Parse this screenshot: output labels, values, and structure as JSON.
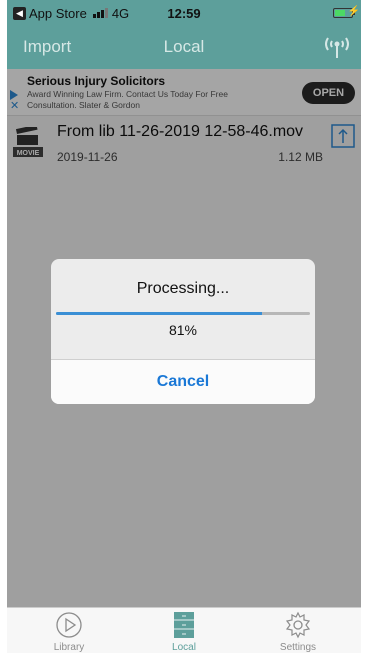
{
  "status_bar": {
    "back_app": "App Store",
    "carrier": "4G",
    "time": "12:59"
  },
  "nav": {
    "import_label": "Import",
    "title": "Local",
    "wifi_icon": "wifi-broadcast-icon"
  },
  "ad": {
    "title": "Serious Injury Solicitors",
    "body": "Award Winning Law Firm. Contact Us Today For Free Consultation. Slater & Gordon",
    "open_label": "OPEN",
    "icons": [
      "ad-play-icon",
      "ad-close-icon"
    ]
  },
  "files": [
    {
      "name": "From lib 11-26-2019 12-58-46.mov",
      "date": "2019-11-26",
      "size": "1.12 MB",
      "thumb_label": "MOVIE",
      "icon": "movie-clapper-icon",
      "action_icon": "upload-icon"
    }
  ],
  "dialog": {
    "title": "Processing...",
    "progress_text": "81%",
    "progress_fraction": 0.81,
    "cancel_label": "Cancel"
  },
  "tabbar": {
    "items": [
      {
        "label": "Library",
        "icon": "play-circle-icon",
        "active": false
      },
      {
        "label": "Local",
        "icon": "stack-drawer-icon",
        "active": true
      },
      {
        "label": "Settings",
        "icon": "gear-icon",
        "active": false
      }
    ]
  },
  "colors": {
    "nav_bg": "#5d9f9b",
    "accent_blue": "#1a78d6",
    "progress": "#3a8fd5"
  }
}
